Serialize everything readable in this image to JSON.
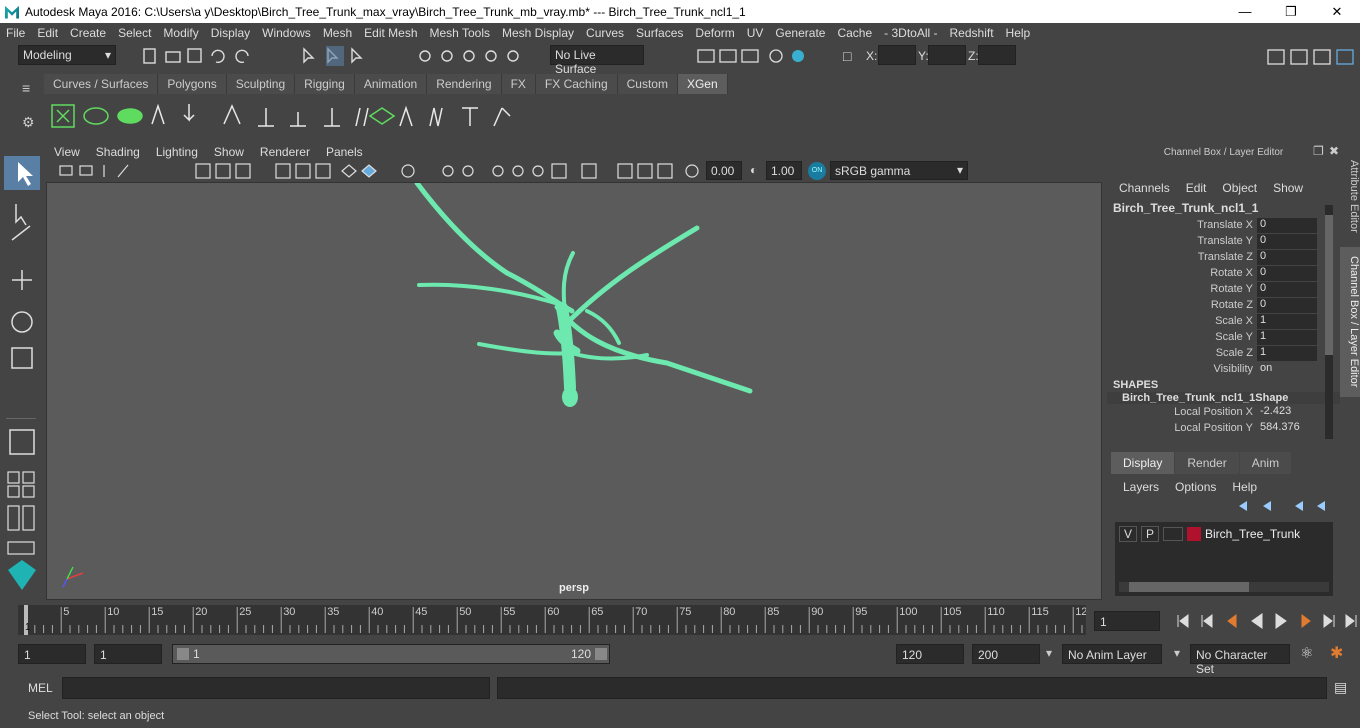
{
  "title": "Autodesk Maya 2016: C:\\Users\\a y\\Desktop\\Birch_Tree_Trunk_max_vray\\Birch_Tree_Trunk_mb_vray.mb*   ---   Birch_Tree_Trunk_ncl1_1",
  "menus": [
    "File",
    "Edit",
    "Create",
    "Select",
    "Modify",
    "Display",
    "Windows",
    "Mesh",
    "Edit Mesh",
    "Mesh Tools",
    "Mesh Display",
    "Curves",
    "Surfaces",
    "Deform",
    "UV",
    "Generate",
    "Cache",
    "- 3DtoAll -",
    "Redshift",
    "Help"
  ],
  "mode_select": "Modeling",
  "live_surface": "No Live Surface",
  "xyz": {
    "x": "X:",
    "y": "Y:",
    "z": "Z:"
  },
  "shelf_tabs": [
    "Curves / Surfaces",
    "Polygons",
    "Sculpting",
    "Rigging",
    "Animation",
    "Rendering",
    "FX",
    "FX Caching",
    "Custom",
    "XGen"
  ],
  "active_shelf": "XGen",
  "viewport_menu": [
    "View",
    "Shading",
    "Lighting",
    "Show",
    "Renderer",
    "Panels"
  ],
  "viewport_fields": {
    "exposure": "0.00",
    "gamma": "1.00",
    "colorspace": "sRGB gamma"
  },
  "camera": "persp",
  "channelbox": {
    "header": "Channel Box / Layer Editor",
    "menu": [
      "Channels",
      "Edit",
      "Object",
      "Show"
    ],
    "object": "Birch_Tree_Trunk_ncl1_1",
    "attrs": [
      {
        "label": "Translate X",
        "value": "0"
      },
      {
        "label": "Translate Y",
        "value": "0"
      },
      {
        "label": "Translate Z",
        "value": "0"
      },
      {
        "label": "Rotate X",
        "value": "0"
      },
      {
        "label": "Rotate Y",
        "value": "0"
      },
      {
        "label": "Rotate Z",
        "value": "0"
      },
      {
        "label": "Scale X",
        "value": "1"
      },
      {
        "label": "Scale Y",
        "value": "1"
      },
      {
        "label": "Scale Z",
        "value": "1"
      },
      {
        "label": "Visibility",
        "value": "on"
      }
    ],
    "shapes_label": "SHAPES",
    "shape": "Birch_Tree_Trunk_ncl1_1Shape",
    "shape_attrs": [
      {
        "label": "Local Position X",
        "value": "-2.423"
      },
      {
        "label": "Local Position Y",
        "value": "584.376"
      }
    ]
  },
  "side_tabs": [
    "Attribute Editor",
    "Channel Box / Layer Editor"
  ],
  "layers": {
    "tabs": [
      "Display",
      "Render",
      "Anim"
    ],
    "menu": [
      "Layers",
      "Options",
      "Help"
    ],
    "row": {
      "v": "V",
      "p": "P",
      "name": "Birch_Tree_Trunk",
      "color": "#b0112d"
    }
  },
  "timeline": {
    "ticks": [
      "5",
      "10",
      "15",
      "20",
      "25",
      "30",
      "35",
      "40",
      "45",
      "50",
      "55",
      "60",
      "65",
      "70",
      "75",
      "80",
      "85",
      "90",
      "95",
      "100",
      "105",
      "110",
      "115",
      "12"
    ],
    "start_marker": "1",
    "current": "1"
  },
  "range": {
    "start": "1",
    "start2": "1",
    "slider_start": "1",
    "slider_end": "120",
    "end": "120",
    "end2": "200",
    "anim_layer": "No Anim Layer",
    "char_set": "No Character Set"
  },
  "mel_label": "MEL",
  "help": "Select Tool: select an object",
  "mesh_color": "#6de8ae"
}
